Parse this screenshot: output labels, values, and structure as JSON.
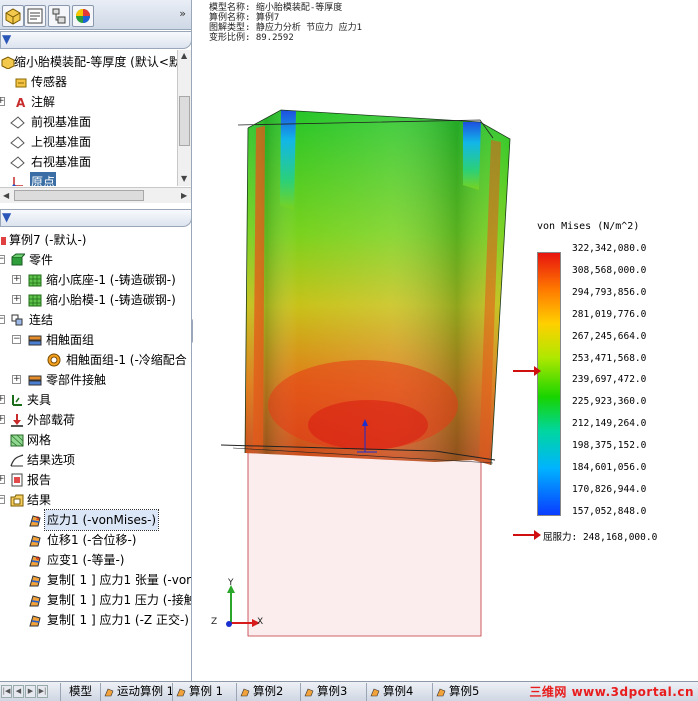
{
  "top_tree": {
    "root_label": "缩小胎模装配-等厚度 (默认<默",
    "items": [
      {
        "label": "传感器",
        "icon": "sensor-icon"
      },
      {
        "label": "注解",
        "icon": "annotation-icon"
      },
      {
        "label": "前视基准面",
        "icon": "plane-icon"
      },
      {
        "label": "上视基准面",
        "icon": "plane-icon"
      },
      {
        "label": "右视基准面",
        "icon": "plane-icon"
      },
      {
        "label": "原点",
        "icon": "origin-icon"
      }
    ]
  },
  "sim_tree": {
    "root_label": "算例7 (-默认-)",
    "parts_label": "零件",
    "part1": "缩小底座-1 (-铸造碳钢-)",
    "part2": "缩小胎模-1 (-铸造碳钢-)",
    "connections_label": "连结",
    "contact_group": "相触面组",
    "contact_set": "相触面组-1 (-冷缩配合",
    "component_contact": "零部件接触",
    "fixtures": "夹具",
    "loads": "外部载荷",
    "mesh": "网格",
    "result_options": "结果选项",
    "report": "报告",
    "results": "结果",
    "result_items": [
      "应力1 (-vonMises-)",
      "位移1 (-合位移-)",
      "应变1 (-等量-)",
      "复制[ 1 ] 应力1 张量 (-vor",
      "复制[ 1 ] 应力1 压力 (-接触",
      "复制[ 1 ] 应力1 (-Z 正交-)"
    ]
  },
  "model_info": {
    "line1": "模型名称: 缩小胎模装配-等厚度",
    "line2": "算例名称: 算例7",
    "line3": "图解类型: 静应力分析 节应力 应力1",
    "line4": "变形比例: 89.2592"
  },
  "legend": {
    "title": "von Mises (N/m^2)",
    "values": [
      "322,342,080.0",
      "308,568,000.0",
      "294,793,856.0",
      "281,019,776.0",
      "267,245,664.0",
      "253,471,568.0",
      "239,697,472.0",
      "225,923,360.0",
      "212,149,264.0",
      "198,375,152.0",
      "184,601,056.0",
      "170,826,944.0",
      "157,052,848.0"
    ],
    "yield_label": "屈服力: 248,168,000.0",
    "max_color": "#e8140f",
    "min_color": "#0a3cff"
  },
  "triad": {
    "x": "X",
    "y": "Y",
    "z": "Z"
  },
  "tabs": [
    "模型",
    "运动算例 1",
    "算例 1",
    "算例2",
    "算例3",
    "算例4",
    "算例5"
  ],
  "watermark": "三维网 www.3dportal.cn"
}
